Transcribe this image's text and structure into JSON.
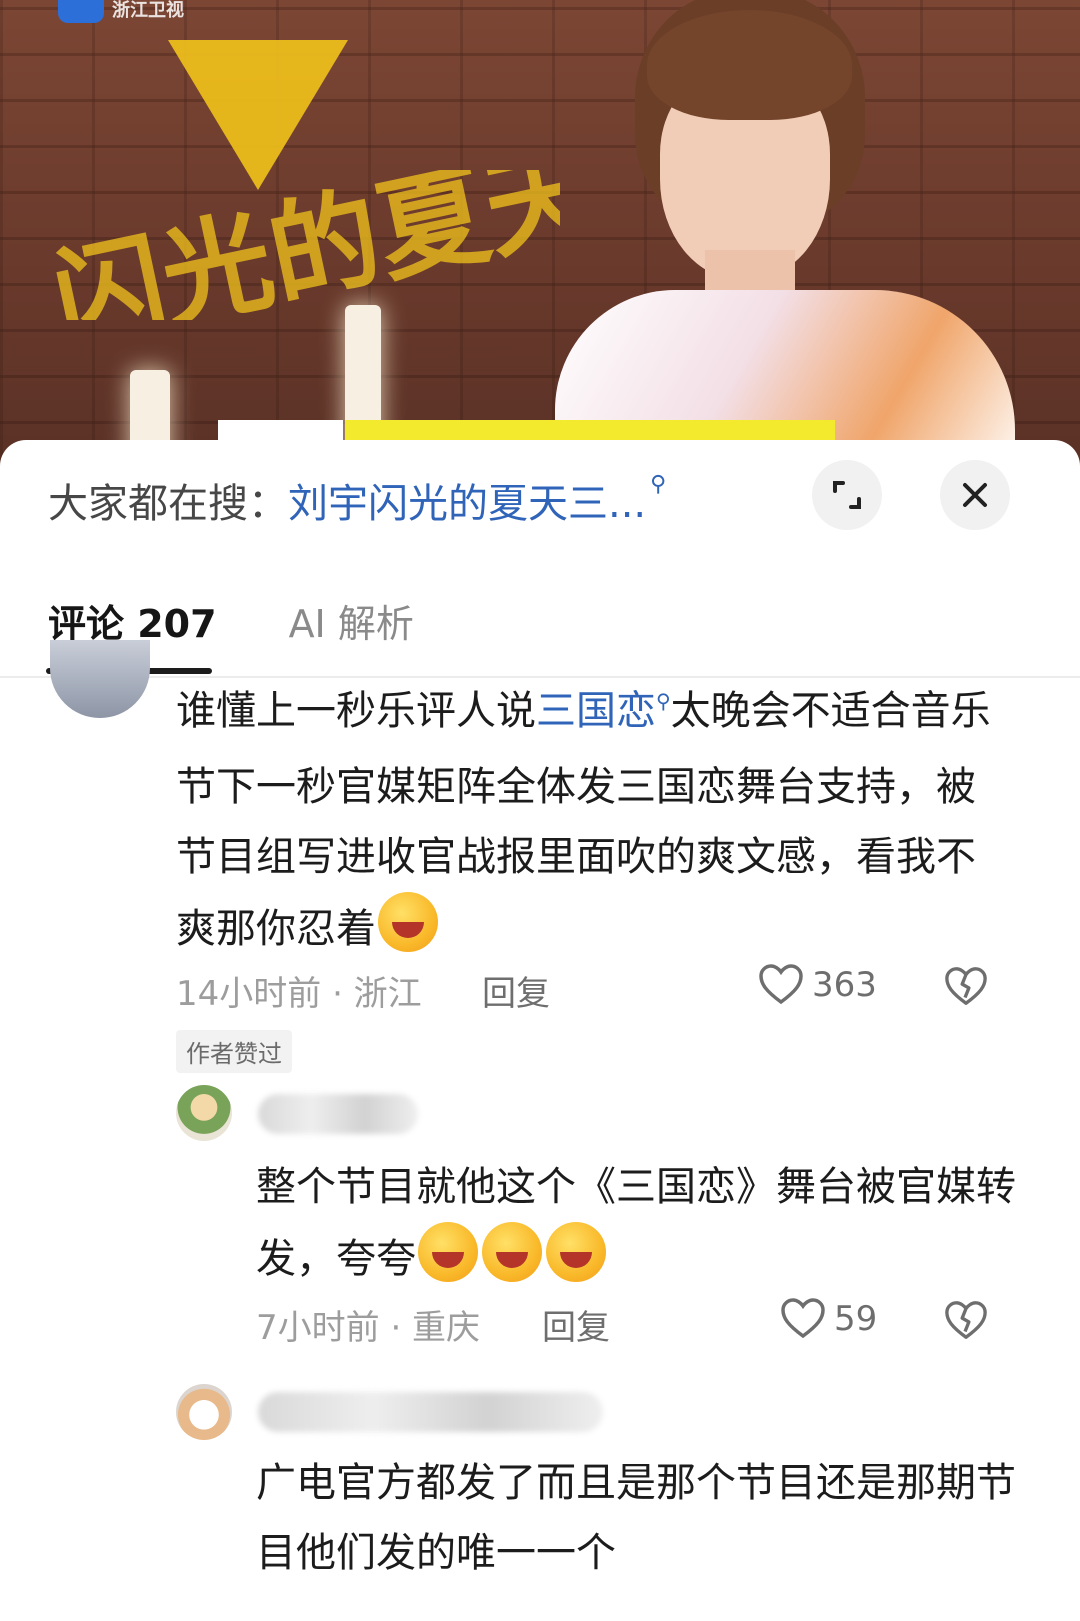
{
  "video": {
    "brand_text": "浙江卫视",
    "show_title": "闪光的夏天"
  },
  "search": {
    "label": "大家都在搜：",
    "query": "刘宇闪光的夏天三..."
  },
  "tabs": [
    {
      "label": "评论 207"
    },
    {
      "label": "AI 解析"
    }
  ],
  "comments": [
    {
      "text_before": "谁懂上一秒乐评人说",
      "link": "三国恋",
      "text_after": "太晚会不适合音乐节下一秒官媒矩阵全体发三国恋舞台支持，被节目组写进收官战报里面吹的爽文感，看我不爽那你忍着",
      "meta": "14小时前 · 浙江",
      "reply": "回复",
      "likes": "363",
      "badge": "作者赞过"
    },
    {
      "text": "整个节目就他这个《三国恋》舞台被官媒转发，夸夸",
      "meta": "7小时前 · 重庆",
      "reply": "回复",
      "likes": "59"
    },
    {
      "text": "广电官方都发了而且是那个节目还是那期节目他们发的唯一一个"
    }
  ],
  "colors": {
    "link": "#2f64b8",
    "meta": "#9d9d9d",
    "accent_yellow": "#f3ea2d"
  },
  "icons": [
    "search-icon",
    "expand-icon",
    "close-icon",
    "heart-icon",
    "dislike-icon",
    "emoji-icon"
  ]
}
